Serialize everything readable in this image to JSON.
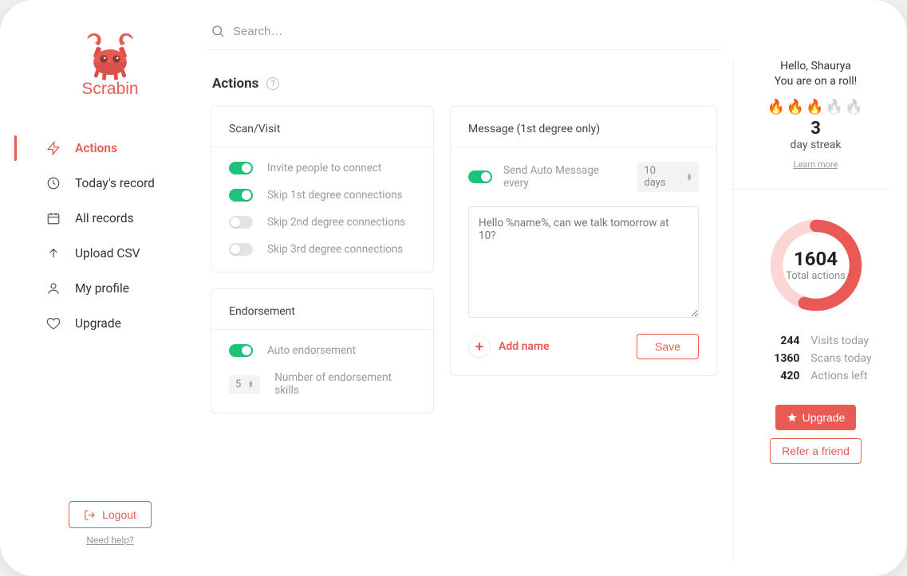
{
  "brand": {
    "name": "Scrabin"
  },
  "search": {
    "placeholder": "Search…"
  },
  "nav": {
    "actions": "Actions",
    "today": "Today's record",
    "all": "All records",
    "upload": "Upload CSV",
    "profile": "My profile",
    "upgrade": "Upgrade"
  },
  "footer": {
    "logout": "Logout",
    "help": "Need help?"
  },
  "page": {
    "title": "Actions"
  },
  "scan": {
    "title": "Scan/Visit",
    "invite": "Invite people to connect",
    "skip1": "Skip 1st degree connections",
    "skip2": "Skip 2nd degree connections",
    "skip3": "Skip 3rd degree connections"
  },
  "endorsement": {
    "title": "Endorsement",
    "auto": "Auto endorsement",
    "skills_label": "Number of endorsement skills",
    "skills_value": "5"
  },
  "message": {
    "title": "Message (1st degree only)",
    "send_every": "Send Auto Message every",
    "interval": "10 days",
    "body_placeholder": "Hello %name%, can we talk tomorrow at 10?",
    "add_name": "Add name",
    "save": "Save"
  },
  "greeting": {
    "line1": "Hello, Shaurya",
    "line2": "You are on a roll!",
    "streak_count": "3",
    "streak_label": "day streak",
    "learn_more": "Learn more"
  },
  "totals": {
    "total_actions_value": "1604",
    "total_actions_label": "Total actions",
    "visits_value": "244",
    "visits_label": "Visits today",
    "scans_value": "1360",
    "scans_label": "Scans today",
    "left_value": "420",
    "left_label": "Actions left"
  },
  "cta": {
    "upgrade": "Upgrade",
    "refer": "Refer a friend"
  },
  "streak_flames": {
    "lit": 3,
    "total": 5
  }
}
